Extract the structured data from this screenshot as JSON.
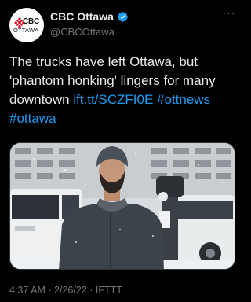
{
  "account": {
    "display_name": "CBC Ottawa",
    "handle": "@CBCOttawa",
    "avatar_text_top": "CBC",
    "avatar_text_bottom": "OTTAWA",
    "verified": true
  },
  "tweet": {
    "text_plain": "The trucks have left Ottawa, but 'phantom honking' lingers for many downtown ",
    "link": "ift.tt/SCZFI0E",
    "hashtag_1": "#ottnews",
    "hashtag_2": "#ottawa"
  },
  "meta": {
    "time": "4:37 AM",
    "separator_1": "·",
    "date": "2/26/22",
    "separator_2": "·",
    "source": "IFTTT"
  },
  "colors": {
    "background": "#000000",
    "text": "#e7e9ea",
    "secondary": "#71767b",
    "link": "#1d9bf0",
    "verified": "#1d9bf0",
    "cbc_red": "#e3001b"
  },
  "icons": {
    "verified": "verified-badge-icon",
    "more": "more-options-icon",
    "cbc_gem": "cbc-gem-logo-icon"
  }
}
